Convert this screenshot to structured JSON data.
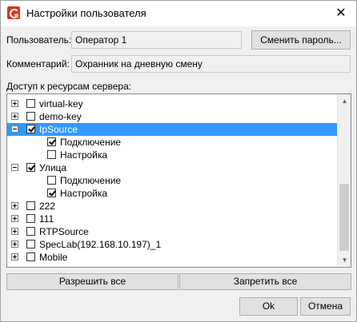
{
  "window": {
    "title": "Настройки пользователя",
    "close_glyph": "✕"
  },
  "user": {
    "label": "Пользователь:",
    "value": "Оператор 1",
    "change_password_label": "Сменить пароль..."
  },
  "comment": {
    "label": "Комментарий:",
    "value": "Охранник на дневную смену"
  },
  "access": {
    "label": "Доступ к ресурсам сервера:",
    "items": [
      {
        "label": "virtual-key",
        "level": 0,
        "expander": "plus",
        "checked": false,
        "selected": false
      },
      {
        "label": "demo-key",
        "level": 0,
        "expander": "plus",
        "checked": false,
        "selected": false
      },
      {
        "label": "IpSource",
        "level": 0,
        "expander": "minus",
        "checked": true,
        "selected": true
      },
      {
        "label": "Подключение",
        "level": 1,
        "expander": "none",
        "checked": true,
        "selected": false
      },
      {
        "label": "Настройка",
        "level": 1,
        "expander": "none",
        "checked": false,
        "selected": false
      },
      {
        "label": "Улица",
        "level": 0,
        "expander": "minus",
        "checked": true,
        "selected": false
      },
      {
        "label": "Подключение",
        "level": 1,
        "expander": "none",
        "checked": false,
        "selected": false
      },
      {
        "label": "Настройка",
        "level": 1,
        "expander": "none",
        "checked": true,
        "selected": false
      },
      {
        "label": "222",
        "level": 0,
        "expander": "plus",
        "checked": false,
        "selected": false
      },
      {
        "label": "111",
        "level": 0,
        "expander": "plus",
        "checked": false,
        "selected": false
      },
      {
        "label": "RTPSource",
        "level": 0,
        "expander": "plus",
        "checked": false,
        "selected": false
      },
      {
        "label": "SpecLab(192.168.10.197)_1",
        "level": 0,
        "expander": "plus",
        "checked": false,
        "selected": false
      },
      {
        "label": "Mobile",
        "level": 0,
        "expander": "plus",
        "checked": false,
        "selected": false
      }
    ],
    "allow_all_label": "Разрешить все",
    "deny_all_label": "Запретить все"
  },
  "footer": {
    "ok_label": "Ok",
    "cancel_label": "Отмена"
  },
  "colors": {
    "selection": "#3399ff",
    "app_icon": "#d23a1e"
  }
}
